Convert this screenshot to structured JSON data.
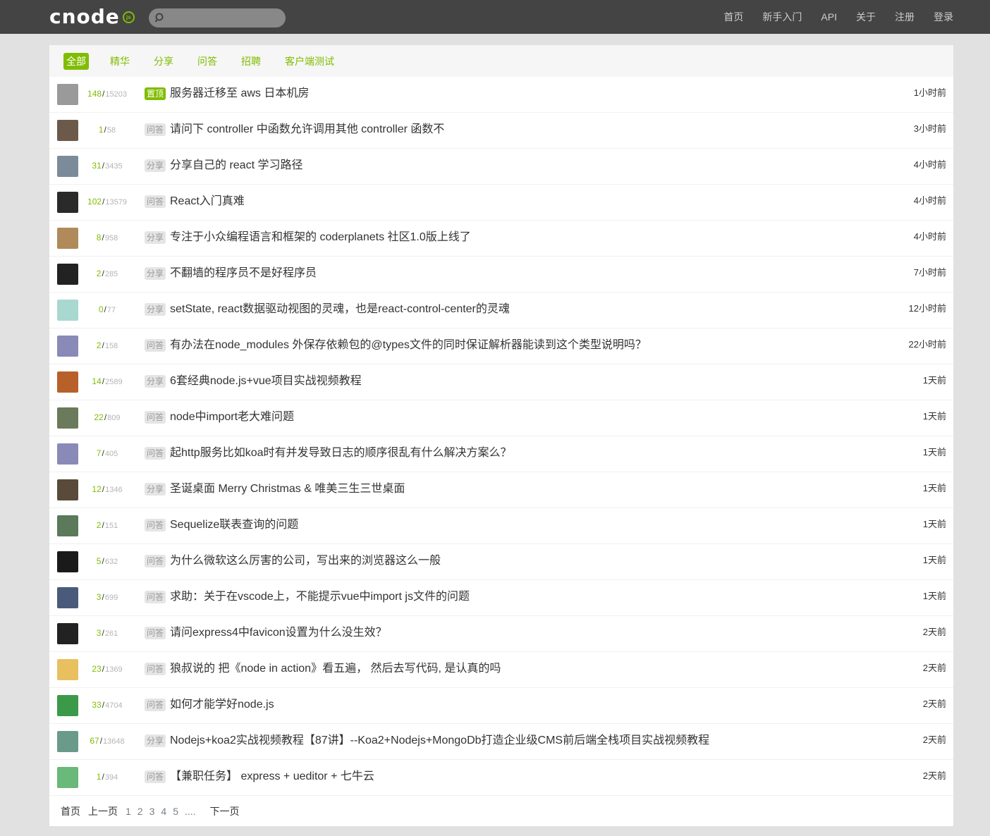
{
  "header": {
    "logo_text": "cnode",
    "logo_badge": "js",
    "search_placeholder": "",
    "nav": [
      "首页",
      "新手入门",
      "API",
      "关于",
      "注册",
      "登录"
    ]
  },
  "tabs": [
    {
      "label": "全部",
      "active": true
    },
    {
      "label": "精华",
      "active": false
    },
    {
      "label": "分享",
      "active": false
    },
    {
      "label": "问答",
      "active": false
    },
    {
      "label": "招聘",
      "active": false
    },
    {
      "label": "客户端测试",
      "active": false
    }
  ],
  "colors": {
    "accent": "#80bd01",
    "nav_bg": "#444444",
    "page_bg": "#e1e1e1"
  },
  "topics": [
    {
      "replies": "148",
      "visits": "15203",
      "tag": "置顶",
      "top": true,
      "title": "服务器迁移至 aws 日本机房",
      "time": "1小时前",
      "avatar_color": "#9a9a9a"
    },
    {
      "replies": "1",
      "visits": "58",
      "tag": "问答",
      "top": false,
      "title": "请问下 controller 中函数允许调用其他 controller 函数不",
      "time": "3小时前",
      "avatar_color": "#6b5a4a"
    },
    {
      "replies": "31",
      "visits": "3435",
      "tag": "分享",
      "top": false,
      "title": "分享自己的 react 学习路径",
      "time": "4小时前",
      "avatar_color": "#7c8b9a"
    },
    {
      "replies": "102",
      "visits": "13579",
      "tag": "问答",
      "top": false,
      "title": "React入门真难",
      "time": "4小时前",
      "avatar_color": "#2a2a2a"
    },
    {
      "replies": "8",
      "visits": "958",
      "tag": "分享",
      "top": false,
      "title": "专注于小众编程语言和框架的 coderplanets 社区1.0版上线了",
      "time": "4小时前",
      "avatar_color": "#b08a5a"
    },
    {
      "replies": "2",
      "visits": "285",
      "tag": "分享",
      "top": false,
      "title": "不翻墙的程序员不是好程序员",
      "time": "7小时前",
      "avatar_color": "#222222"
    },
    {
      "replies": "0",
      "visits": "77",
      "tag": "分享",
      "top": false,
      "title": "setState, react数据驱动视图的灵魂，也是react-control-center的灵魂",
      "time": "12小时前",
      "avatar_color": "#a8d8d0"
    },
    {
      "replies": "2",
      "visits": "158",
      "tag": "问答",
      "top": false,
      "title": "有办法在node_modules 外保存依赖包的@types文件的同时保证解析器能读到这个类型说明吗？",
      "time": "22小时前",
      "avatar_color": "#8a8ab8"
    },
    {
      "replies": "14",
      "visits": "2589",
      "tag": "分享",
      "top": false,
      "title": "6套经典node.js+vue项目实战视频教程",
      "time": "1天前",
      "avatar_color": "#b8602a"
    },
    {
      "replies": "22",
      "visits": "809",
      "tag": "问答",
      "top": false,
      "title": "node中import老大难问题",
      "time": "1天前",
      "avatar_color": "#6a7a5a"
    },
    {
      "replies": "7",
      "visits": "405",
      "tag": "问答",
      "top": false,
      "title": "起http服务比如koa时有并发导致日志的顺序很乱有什么解决方案么？",
      "time": "1天前",
      "avatar_color": "#8a8ab8"
    },
    {
      "replies": "12",
      "visits": "1346",
      "tag": "分享",
      "top": false,
      "title": "圣诞桌面 Merry Christmas & 唯美三生三世桌面",
      "time": "1天前",
      "avatar_color": "#5a4a3a"
    },
    {
      "replies": "2",
      "visits": "151",
      "tag": "问答",
      "top": false,
      "title": "Sequelize联表查询的问题",
      "time": "1天前",
      "avatar_color": "#5a7a5a"
    },
    {
      "replies": "5",
      "visits": "632",
      "tag": "问答",
      "top": false,
      "title": "为什么微软这么厉害的公司，写出来的浏览器这么一般",
      "time": "1天前",
      "avatar_color": "#1a1a1a"
    },
    {
      "replies": "3",
      "visits": "699",
      "tag": "问答",
      "top": false,
      "title": "求助：关于在vscode上，不能提示vue中import js文件的问题",
      "time": "1天前",
      "avatar_color": "#4a5a7a"
    },
    {
      "replies": "3",
      "visits": "261",
      "tag": "问答",
      "top": false,
      "title": "请问express4中favicon设置为什么没生效？",
      "time": "2天前",
      "avatar_color": "#222222"
    },
    {
      "replies": "23",
      "visits": "1369",
      "tag": "问答",
      "top": false,
      "title": "狼叔说的 把《node in action》看五遍， 然后去写代码, 是认真的吗",
      "time": "2天前",
      "avatar_color": "#e8c060"
    },
    {
      "replies": "33",
      "visits": "4704",
      "tag": "问答",
      "top": false,
      "title": "如何才能学好node.js",
      "time": "2天前",
      "avatar_color": "#3a9a4a"
    },
    {
      "replies": "67",
      "visits": "13648",
      "tag": "分享",
      "top": false,
      "title": "Nodejs+koa2实战视频教程【87讲】--Koa2+Nodejs+MongoDb打造企业级CMS前后端全栈项目实战视频教程",
      "time": "2天前",
      "avatar_color": "#6a9a8a"
    },
    {
      "replies": "1",
      "visits": "394",
      "tag": "问答",
      "top": false,
      "title": "【兼职任务】 express + ueditor + 七牛云",
      "time": "2天前",
      "avatar_color": "#6ab87a"
    }
  ],
  "pagination": {
    "first": "首页",
    "prev": "上一页",
    "pages": [
      "1",
      "2",
      "3",
      "4",
      "5"
    ],
    "current": "1",
    "ellipsis": "....",
    "next": "下一页"
  }
}
